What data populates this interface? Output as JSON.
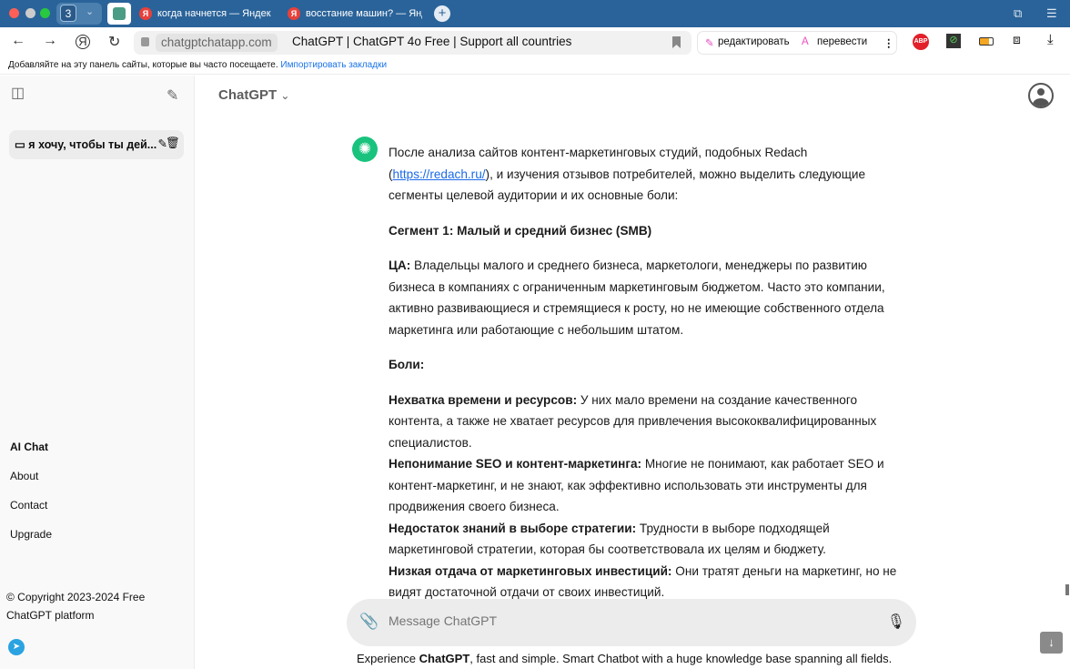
{
  "browser": {
    "tab_group_count": "3",
    "tabs": [
      {
        "label": "когда начнется — Яндекс"
      },
      {
        "label": "восстание машин? — Янд"
      }
    ],
    "host": "chatgptchatapp.com",
    "page_title": "ChatGPT | ChatGPT 4o Free | Support all countries",
    "edit_label": "редактировать",
    "translate_label": "перевести",
    "abp_label": "ABP",
    "bookmarks_hint": "Добавляйте на эту панель сайты, которые вы часто посещаете.",
    "import_link": "Импортировать закладки"
  },
  "sidebar": {
    "conversation": "я хочу, чтобы ты дей...",
    "links": [
      "AI Chat",
      "About",
      "Contact",
      "Upgrade"
    ],
    "copyright": "© Copyright 2023-2024 Free ChatGPT platform"
  },
  "header": {
    "model": "ChatGPT"
  },
  "message": {
    "intro_1": "После анализа сайтов контент-маркетинговых студий, подобных Redach (",
    "intro_link": "https://redach.ru/",
    "intro_2": "), и изучения отзывов потребителей, можно выделить следующие сегменты целевой аудитории и их основные боли:",
    "segment": "Сегмент 1: Малый и средний бизнес (SMB)",
    "ta_label": "ЦА:",
    "ta_text": " Владельцы малого и среднего бизнеса, маркетологи, менеджеры по развитию бизнеса в компаниях с ограниченным маркетинговым бюджетом. Часто это компании, активно развивающиеся и стремящиеся к росту, но не имеющие собственного отдела маркетинга или работающие с небольшим штатом.",
    "pains_label": "Боли:",
    "pains": [
      {
        "title": "Нехватка времени и ресурсов:",
        "text": " У них мало времени на создание качественного контента, а также не хватает ресурсов для привлечения высококвалифицированных специалистов."
      },
      {
        "title": "Непонимание SEO и контент-маркетинга:",
        "text": " Многие не понимают, как работает SEO и контент-маркетинг, и не знают, как эффективно использовать эти инструменты для продвижения своего бизнеса."
      },
      {
        "title": "Недостаток знаний в выборе стратегии:",
        "text": " Трудности в выборе подходящей маркетинговой стратегии, которая бы соответствовала их целям и бюджету."
      },
      {
        "title": "Низкая отдача от маркетинговых инвестиций:",
        "text": " Они тратят деньги на маркетинг, но не видят достаточной отдачи от своих инвестиций."
      }
    ]
  },
  "composer": {
    "placeholder": "Message ChatGPT"
  },
  "footer": {
    "pre": "Experience ",
    "brand": "ChatGPT",
    "post": ", fast and simple. Smart Chatbot with a huge knowledge base spanning all fields."
  }
}
